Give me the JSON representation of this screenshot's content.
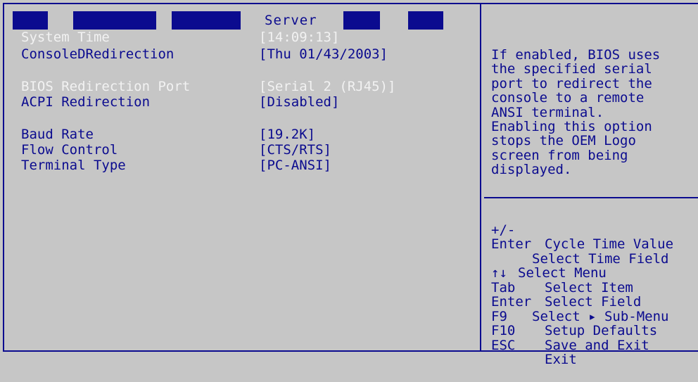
{
  "header": {
    "tabs": [
      {
        "label": ""
      },
      {
        "label": ""
      },
      {
        "label": ""
      },
      {
        "label": "Server"
      },
      {
        "label": ""
      },
      {
        "label": ""
      }
    ],
    "active_tab": "Server"
  },
  "settings": [
    {
      "label": "System Time",
      "value_prefix": "[",
      "value_hl": "14",
      "value_suffix": ":09:13]",
      "dim": true
    },
    {
      "label": "ConsoleDRedirection",
      "value_prefix": "[Thu 01/43/2003]",
      "value_hl": "",
      "value_suffix": "",
      "dim": false
    },
    {
      "label": "BIOS Redirection Port",
      "value_prefix": "[Serial 2 (RJ45)]",
      "value_hl": "",
      "value_suffix": "",
      "dim": true
    },
    {
      "label": "ACPI Redirection",
      "value_prefix": "[Disabled]",
      "value_hl": "",
      "value_suffix": "",
      "dim": false
    },
    {
      "label": "Baud Rate",
      "value_prefix": "[19.2K]",
      "value_hl": "",
      "value_suffix": "",
      "dim": false
    },
    {
      "label": "Flow Control",
      "value_prefix": "[CTS/RTS]",
      "value_hl": "",
      "value_suffix": "",
      "dim": false
    },
    {
      "label": "Terminal Type",
      "value_prefix": "[PC-ANSI]",
      "value_hl": "",
      "value_suffix": "",
      "dim": false
    }
  ],
  "help": {
    "text": "If enabled, BIOS uses\nthe specified serial\nport to redirect the\nconsole to a remote\nANSI terminal.\nEnabling this option\nstops the OEM Logo\nscreen from being\ndisplayed."
  },
  "keys": [
    {
      "key": "+/-",
      "desc": "Cycle Time Value"
    },
    {
      "key": "Enter",
      "desc": "Select Time Field"
    },
    {
      "key": "",
      "desc": "Select Menu"
    },
    {
      "key": "↑↓",
      "desc": "Select Item"
    },
    {
      "key": "Tab",
      "desc": "Select Field"
    },
    {
      "key": "Enter",
      "desc": "Select ▸ Sub-Menu"
    },
    {
      "key": "F9",
      "desc": "Setup Defaults"
    },
    {
      "key": "F10",
      "desc": "Save and Exit"
    },
    {
      "key": "ESC",
      "desc": "Exit"
    }
  ],
  "colors": {
    "background": "#c6c6c6",
    "text": "#0b0b8f",
    "highlight_text": "#f2f2f2",
    "frame": "#0b0b8f"
  }
}
